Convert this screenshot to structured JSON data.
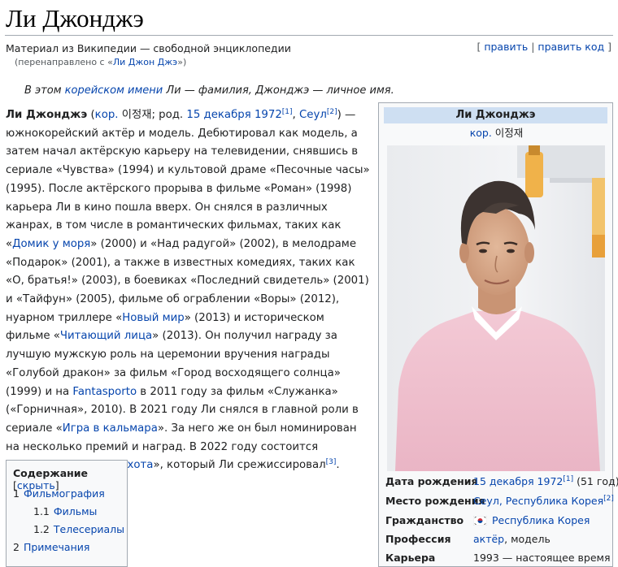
{
  "title": "Ли Джонджэ",
  "tagline": "Материал из Википедии — свободной энциклопедии",
  "redirect": {
    "prefix": "(перенаправлено с «",
    "link": "Ли Джон Джэ",
    "suffix": "»)"
  },
  "edit_links": {
    "edit": "править",
    "edit_code": "править код"
  },
  "hatnote": {
    "t1": "В этом ",
    "link": "корейском имени",
    "t2": " Ли — фамилия, Джонджэ — личное имя."
  },
  "paragraph": {
    "name": "Ли Джонджэ",
    "t1": " (",
    "kor": "кор.",
    "t2": " 이정재; род. ",
    "dob": "15 декабря 1972",
    "ref1": "[1]",
    "t3": ", ",
    "seoul": "Сеул",
    "ref2": "[2]",
    "t4": ") — южнокорейский актёр и модель. Дебютировал как модель, а затем начал актёрскую карьеру на телевидении, снявшись в сериале «Чувства» (1994) и культовой драме «Песочные часы» (1995). После актёрского прорыва в фильме «Роман» (1998) карьера Ли в кино пошла вверх. Он снялся в различных жанрах, в том числе в романтических фильмах, таких как «",
    "house": "Домик у моря",
    "t5": "» (2000) и «Над радугой» (2002), в мелодраме «Подарок» (2001), а также в известных комедиях, таких как «О, братья!» (2003), в боевиках «Последний свидетель» (2001) и «Тайфун» (2005), фильме об ограблении «Воры» (2012), нуарном триллере «",
    "newworld": "Новый мир",
    "t6": "» (2013) и историческом фильме «",
    "faces": "Читающий лица",
    "t7": "» (2013). Он получил награду за лучшую мужскую роль на церемонии вручения награды «Голубой дракон» за фильм «Город восходящего солнца» (1999) и на ",
    "fanta": "Fantasporto",
    "t8": " в 2011 году за фильм «Служанка» («Горничная», 2010). В 2021 году Ли снялся в главной роли в сериале «",
    "squid": "Игра в кальмара",
    "t9": "». За него же он был номинирован на несколько премий и наград. В 2022 году состоится премьера фильма «",
    "hunt": "Охота",
    "t10": "», который Ли срежиссировал",
    "ref3": "[3]",
    "t11": "."
  },
  "toc": {
    "title": "Содержание",
    "hide_open": " [",
    "hide": "скрыть",
    "hide_close": "]",
    "items": [
      {
        "num": "1",
        "label": "Фильмография"
      },
      {
        "num": "1.1",
        "label": "Фильмы"
      },
      {
        "num": "1.2",
        "label": "Телесериалы"
      },
      {
        "num": "2",
        "label": "Примечания"
      }
    ]
  },
  "infobox": {
    "name": "Ли Джонджэ",
    "kor": "кор.",
    "hangul": " 이정재",
    "rows": {
      "birth_date": {
        "label": "Дата рождения",
        "link": "15 декабря 1972",
        "ref": "[1]",
        "extra": " (51 год)"
      },
      "birth_place": {
        "label": "Место рождения",
        "city": "Сеул",
        "sep": ", ",
        "country": "Республика Корея",
        "ref": "[2]"
      },
      "citizenship": {
        "label": "Гражданство",
        "country": "Республика Корея"
      },
      "profession": {
        "label": "Профессия",
        "link": "актёр",
        "extra": ", модель"
      },
      "career": {
        "label": "Карьера",
        "value": "1993 — настоящее время"
      }
    }
  },
  "colors": {
    "link": "#0645ad",
    "infobox_header": "#cedff2",
    "border": "#a2a9b1"
  },
  "icons": {
    "flag": "south-korea-flag-icon"
  }
}
